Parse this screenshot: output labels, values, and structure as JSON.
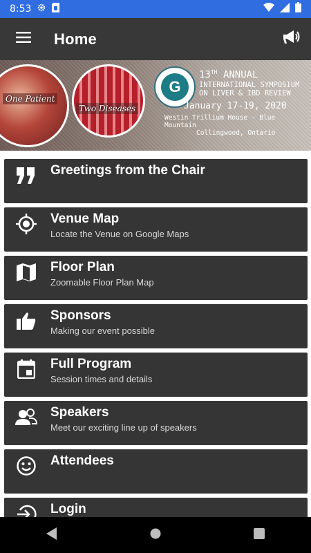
{
  "status_bar": {
    "time": "8:53",
    "icons": [
      "settings-icon",
      "sim-card-icon",
      "wifi-icon",
      "signal-icon",
      "battery-icon"
    ]
  },
  "app_bar": {
    "title": "Home",
    "left_icon": "hamburger-menu-icon",
    "right_icon": "megaphone-icon"
  },
  "banner": {
    "circle_one_label": "One Patient",
    "circle_two_label": "Two Diseases",
    "annual_num": "13",
    "annual_sup": "TH",
    "annual_text": "ANNUAL",
    "symposium_line1": "INTERNATIONAL SYMPOSIUM",
    "symposium_line2": "ON LIVER & IBD REVIEW",
    "dates": "January 17-19, 2020",
    "venue": "Westin Trillium House - Blue Mountain",
    "city": "Collingwood, Ontario"
  },
  "menu": [
    {
      "title": "Greetings from the Chair",
      "subtitle": "",
      "icon": "quote-icon"
    },
    {
      "title": "Venue Map",
      "subtitle": "Locate the Venue on Google Maps",
      "icon": "target-location-icon"
    },
    {
      "title": "Floor Plan",
      "subtitle": "Zoomable Floor Plan Map",
      "icon": "map-icon"
    },
    {
      "title": "Sponsors",
      "subtitle": "Making our event possible",
      "icon": "thumbs-up-icon"
    },
    {
      "title": "Full Program",
      "subtitle": "Session times and details",
      "icon": "calendar-icon"
    },
    {
      "title": "Speakers",
      "subtitle": "Meet our exciting line up of speakers",
      "icon": "people-icon"
    },
    {
      "title": "Attendees",
      "subtitle": "",
      "icon": "smiley-face-icon"
    },
    {
      "title": "Login",
      "subtitle": "",
      "icon": "login-icon"
    }
  ],
  "nav_bar": {
    "icons": [
      "back-icon",
      "home-icon",
      "recents-icon"
    ]
  },
  "colors": {
    "status_bar": "#2f6de1",
    "app_bar": "#383838",
    "menu_item": "#353535",
    "nav_bar": "#000000"
  }
}
